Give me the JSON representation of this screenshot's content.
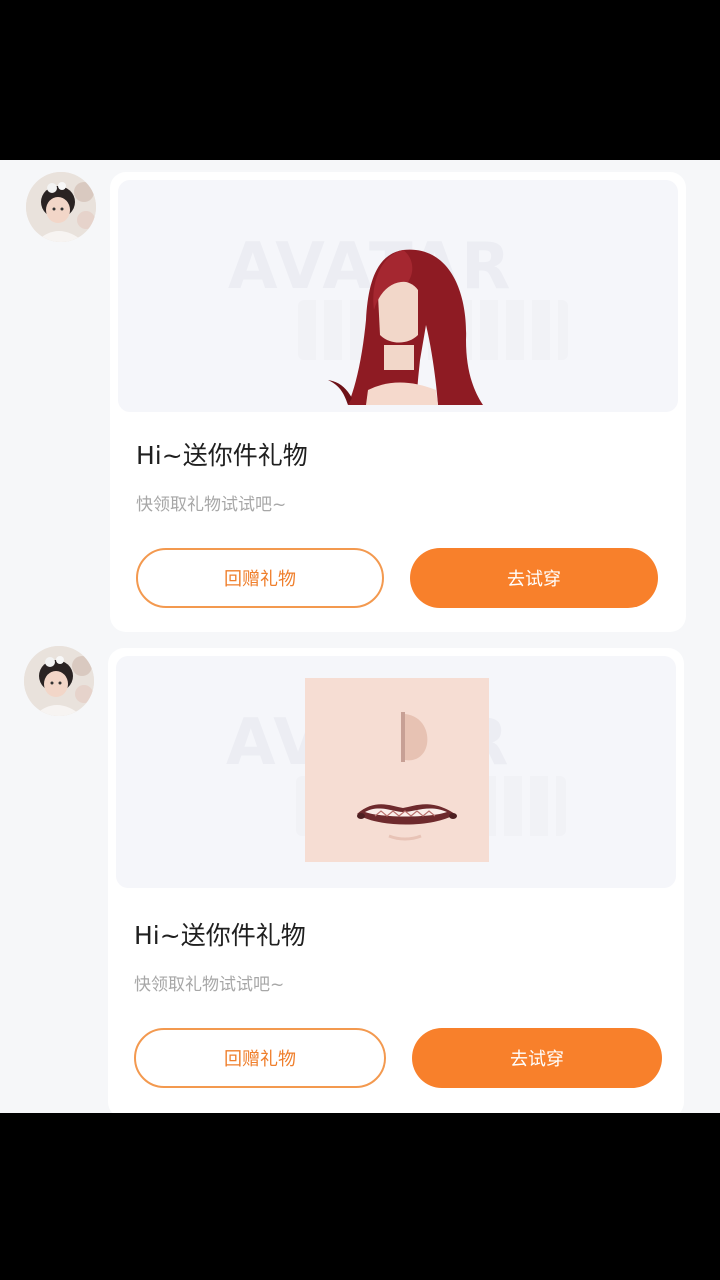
{
  "messages": [
    {
      "avatar_icon": "user-avatar-photo",
      "gift_item": "hair-item-image",
      "title": "Hi~送你件礼物",
      "subtitle": "快领取礼物试试吧~",
      "return_gift_label": "回赠礼物",
      "try_on_label": "去试穿"
    },
    {
      "avatar_icon": "user-avatar-photo",
      "gift_item": "face-makeup-item-image",
      "title": "Hi~送你件礼物",
      "subtitle": "快领取礼物试试吧~",
      "return_gift_label": "回赠礼物",
      "try_on_label": "去试穿"
    }
  ],
  "watermark_text": "AVATAR",
  "colors": {
    "accent": "#f8802b",
    "outline": "#f3994f",
    "page_bg": "#f6f7f9",
    "letterbox": "#000000"
  }
}
